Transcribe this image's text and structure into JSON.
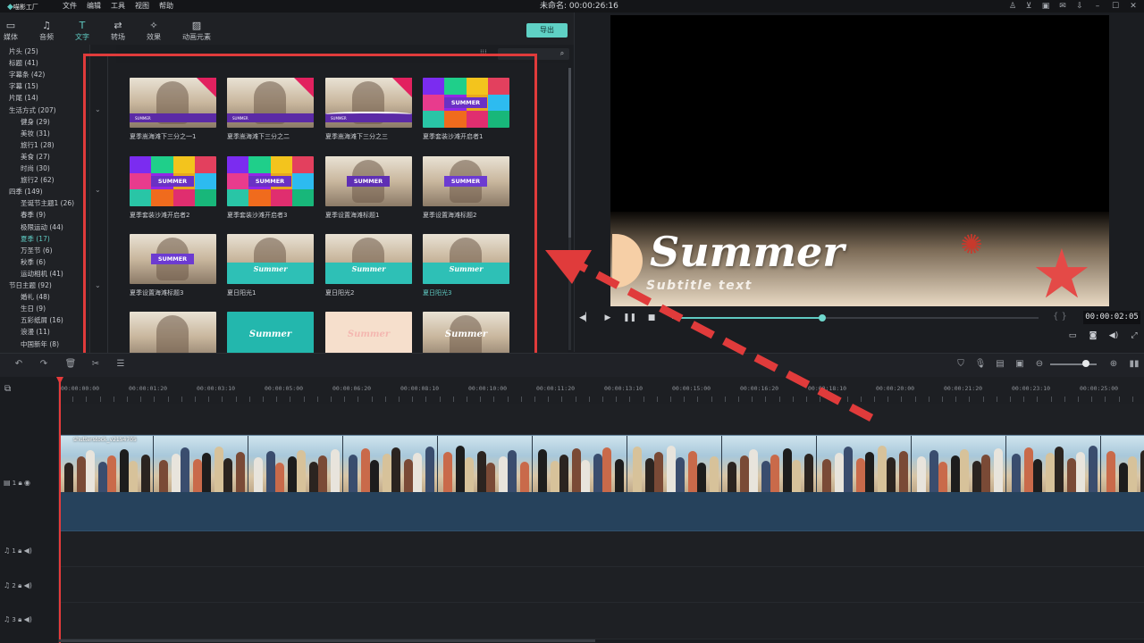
{
  "app": {
    "logo_text": "喵影工厂",
    "title": "未命名: 00:00:26:16"
  },
  "menu": [
    "文件",
    "编辑",
    "工具",
    "视图",
    "帮助"
  ],
  "toolbar": {
    "tabs": [
      {
        "label": "媒体",
        "icon": "folder-icon"
      },
      {
        "label": "音频",
        "icon": "music-note-icon"
      },
      {
        "label": "文字",
        "icon": "text-icon"
      },
      {
        "label": "转场",
        "icon": "transition-icon"
      },
      {
        "label": "效果",
        "icon": "effects-icon"
      },
      {
        "label": "动画元素",
        "icon": "image-icon"
      }
    ],
    "active_tab": "文字",
    "export_label": "导出"
  },
  "categories": [
    {
      "label": "片头 (25)",
      "sub": false
    },
    {
      "label": "标题 (41)",
      "sub": false
    },
    {
      "label": "字幕条 (42)",
      "sub": false
    },
    {
      "label": "字幕 (15)",
      "sub": false
    },
    {
      "label": "片尾 (14)",
      "sub": false
    },
    {
      "label": "生活方式 (207)",
      "sub": false
    },
    {
      "label": "健身 (29)",
      "sub": true
    },
    {
      "label": "美妆 (31)",
      "sub": true
    },
    {
      "label": "旅行1 (28)",
      "sub": true
    },
    {
      "label": "美食 (27)",
      "sub": true
    },
    {
      "label": "时尚 (30)",
      "sub": true
    },
    {
      "label": "旅行2 (62)",
      "sub": true
    },
    {
      "label": "四季 (149)",
      "sub": false
    },
    {
      "label": "圣诞节主题1 (26)",
      "sub": true
    },
    {
      "label": "春季 (9)",
      "sub": true
    },
    {
      "label": "极限运动 (44)",
      "sub": true
    },
    {
      "label": "夏季 (17)",
      "sub": true,
      "selected": true
    },
    {
      "label": "万圣节 (6)",
      "sub": true
    },
    {
      "label": "秋季 (6)",
      "sub": true
    },
    {
      "label": "运动相机 (41)",
      "sub": true
    },
    {
      "label": "节日主题 (92)",
      "sub": false
    },
    {
      "label": "婚礼 (48)",
      "sub": true
    },
    {
      "label": "生日 (9)",
      "sub": true
    },
    {
      "label": "五彩纸屑 (16)",
      "sub": true
    },
    {
      "label": "浪漫 (11)",
      "sub": true
    },
    {
      "label": "中国新年 (8)",
      "sub": true
    }
  ],
  "gallery": {
    "search_placeholder": "",
    "items": [
      {
        "label": "夏季嵩海滩下三分之一1",
        "style": "lower-third",
        "chip": "SUMMER"
      },
      {
        "label": "夏季嵩海滩下三分之二",
        "style": "lower-third",
        "chip": "SUMMER"
      },
      {
        "label": "夏季嵩海滩下三分之三",
        "style": "lower-third-swoosh",
        "chip": "SUMMER"
      },
      {
        "label": "夏季套装沙滩开启者1",
        "style": "mosaic",
        "chip": "SUMMER"
      },
      {
        "label": "夏季套装沙滩开启者2",
        "style": "mosaic",
        "chip": "SUMMER"
      },
      {
        "label": "夏季套装沙滩开启者3",
        "style": "mosaic",
        "chip": "SUMMER"
      },
      {
        "label": "夏季设置海滩标题1",
        "style": "chip",
        "chip": "SUMMER"
      },
      {
        "label": "夏季设置海滩标题2",
        "style": "chip-alt",
        "chip": "SUMMER"
      },
      {
        "label": "夏季设置海滩标题3",
        "style": "chip-alt",
        "chip": "SUMMER"
      },
      {
        "label": "夏日阳光1",
        "style": "teal-base",
        "chip": "Summer"
      },
      {
        "label": "夏日阳光2",
        "style": "teal-base",
        "chip": "Summer"
      },
      {
        "label": "夏日阳光3",
        "style": "teal-base",
        "chip": "Summer",
        "selected": true
      },
      {
        "label": "",
        "style": "photo",
        "chip": ""
      },
      {
        "label": "",
        "style": "teal-full",
        "chip": "Summer"
      },
      {
        "label": "",
        "style": "peach-full",
        "chip": "Summer"
      },
      {
        "label": "",
        "style": "photo-script",
        "chip": "Summer"
      }
    ]
  },
  "preview": {
    "title": "Summer",
    "subtitle": "Subtitle text",
    "timecode": "00:00:02:05",
    "progress": 0.41
  },
  "timeline": {
    "ruler": [
      "00:00:00:00",
      "00:00:01:20",
      "00:00:03:10",
      "00:00:05:00",
      "00:00:06:20",
      "00:00:08:10",
      "00:00:10:00",
      "00:00:11:20",
      "00:00:13:10",
      "00:00:15:00",
      "00:00:16:20",
      "00:00:18:10",
      "00:00:20:00",
      "00:00:21:20",
      "00:00:23:10",
      "00:00:25:00"
    ],
    "clip_name": "shutterstock_v2154705",
    "tracks": [
      {
        "label": "1",
        "type": "video"
      },
      {
        "label": "1",
        "type": "audio"
      },
      {
        "label": "2",
        "type": "audio"
      },
      {
        "label": "3",
        "type": "audio"
      }
    ]
  },
  "colors": {
    "accent": "#5fc9c1",
    "annotation": "#e03b3b"
  }
}
